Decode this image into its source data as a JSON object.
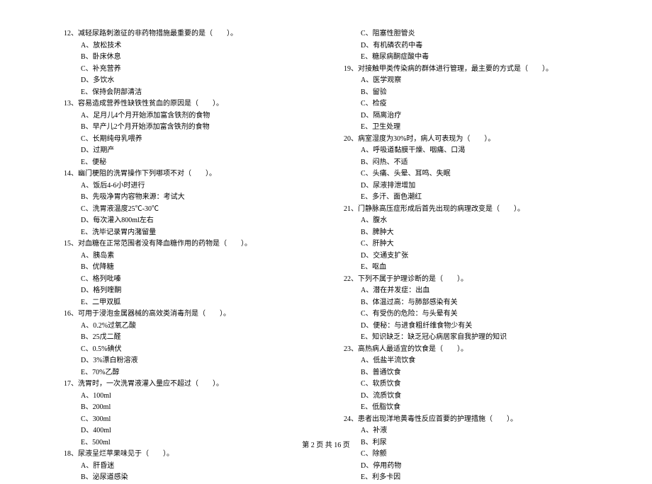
{
  "left_column": [
    {
      "q": "12、减轻尿路刺激征的非药物措施最重要的是（　　）。",
      "opts": [
        "A、放松技术",
        "B、卧床休息",
        "C、补充营养",
        "D、多饮水",
        "E、保持会阴部清洁"
      ]
    },
    {
      "q": "13、容易造成营养性缺铁性贫血的原因是（　　）。",
      "opts": [
        "A、足月儿4个月开始添加富含铁剂的食物",
        "B、早产儿2个月开始添加富含铁剂的食物",
        "C、长期纯母乳喂养",
        "D、过期产",
        "E、便秘"
      ]
    },
    {
      "q": "14、幽门梗阻的洗胃操作下列哪项不对（　　）。",
      "opts": [
        "A、饭后4-6小时进行",
        "B、先吸净胃内容物来源：考试大",
        "C、洗胃液温度25℃-30℃",
        "D、每次灌入800ml左右",
        "E、洗毕记录胃内潴留量"
      ]
    },
    {
      "q": "15、对血糖在正常范围者没有降血糖作用的药物是（　　）。",
      "opts": [
        "A、胰岛素",
        "B、优降糖",
        "C、格列吡嗪",
        "D、格列喹酮",
        "E、二甲双胍"
      ]
    },
    {
      "q": "16、可用于浸泡金属器械的高效类消毒剂是（　　）。",
      "opts": [
        "A、0.2%过氧乙酸",
        "B、25戊二醛",
        "C、0.5%碘伏",
        "D、3%漂白粉溶液",
        "E、70%乙醇"
      ]
    },
    {
      "q": "17、洗胃时，一次洗胃液灌入量应不超过（　　）。",
      "opts": [
        "A、100ml",
        "B、200ml",
        "C、300ml",
        "D、400ml",
        "E、500ml"
      ]
    },
    {
      "q": "18、尿液呈烂苹果味见于（　　）。",
      "opts": [
        "A、肝昏迷",
        "B、泌尿道感染"
      ]
    }
  ],
  "right_column_prefix": [
    "C、阻塞性胆管炎",
    "D、有机磷农药中毒",
    "E、糖尿病酮症酸中毒"
  ],
  "right_column": [
    {
      "q": "19、对接触甲类传染病的群体进行管理，最主要的方式是（　　）。",
      "opts": [
        "A、医学观察",
        "B、留验",
        "C、检疫",
        "D、隔离治疗",
        "E、卫生处理"
      ]
    },
    {
      "q": "20、病室湿度为30%时，病人可表现为（　　）。",
      "opts": [
        "A、呼吸道黏膜干燥、咽痛、口渴",
        "B、闷热、不适",
        "C、头痛、头晕、耳鸣、失眠",
        "D、尿液排泄增加",
        "E、多汗、面色潮红"
      ]
    },
    {
      "q": "21、门静脉高压症形成后首先出现的病理改变是（　　）。",
      "opts": [
        "A、腹水",
        "B、脾肿大",
        "C、肝肿大",
        "D、交通支扩张",
        "E、呕血"
      ]
    },
    {
      "q": "22、下列不属于护理诊断的是（　　）。",
      "opts": [
        "A、潜在并发症：出血",
        "B、体温过高：与肺部感染有关",
        "C、有受伤的危险：与头晕有关",
        "D、便秘：与进食粗纤维食物少有关",
        "E、知识缺乏：缺乏冠心病居家自我护理的知识"
      ]
    },
    {
      "q": "23、高热病人最适宜的饮食是（　　）。",
      "opts": [
        "A、低盐半流饮食",
        "B、普通饮食",
        "C、软质饮食",
        "D、流质饮食",
        "E、低脂饮食"
      ]
    },
    {
      "q": "24、患者出现洋地黄毒性反应首要的护理措施（　　）。",
      "opts": [
        "A、补液",
        "B、利尿",
        "C、除颤",
        "D、停用药物",
        "E、利多卡因"
      ]
    }
  ],
  "footer": "第 2 页 共 16 页"
}
